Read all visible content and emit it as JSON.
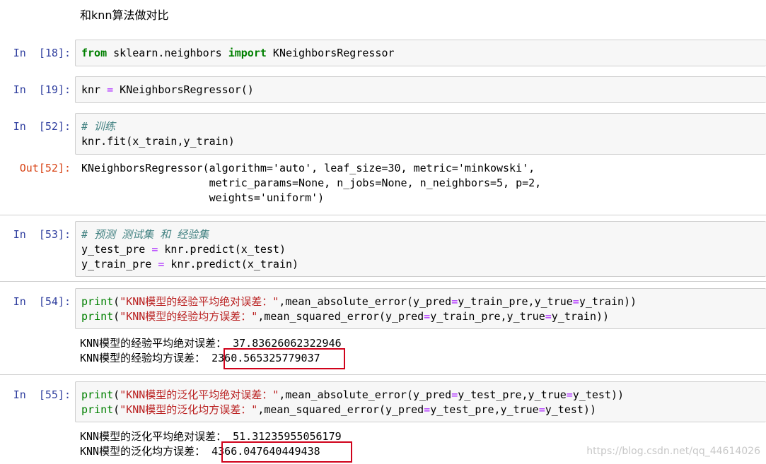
{
  "markdown": "和knn算法做对比",
  "cells": [
    {
      "prompt": "In  [18]:",
      "line1_kw1": "from",
      "line1_mid": " sklearn.neighbors ",
      "line1_kw2": "import",
      "line1_end": " KNeighborsRegressor"
    },
    {
      "prompt": "In  [19]:",
      "a": "knr ",
      "op": "=",
      "b": " KNeighborsRegressor()"
    },
    {
      "prompt": "In  [52]:",
      "comment": "# 训练",
      "code": "knr.fit(x_train,y_train)",
      "out_prompt": "Out[52]:",
      "out_lines": [
        "KNeighborsRegressor(algorithm='auto', leaf_size=30, metric='minkowski',",
        "                    metric_params=None, n_jobs=None, n_neighbors=5, p=2,",
        "                    weights='uniform')"
      ]
    },
    {
      "prompt": "In  [53]:",
      "comment": "# 预测 测试集 和 经验集",
      "l2a": "y_test_pre ",
      "l2op": "=",
      "l2b": " knr.predict(x_test)",
      "l3a": "y_train_pre ",
      "l3op": "=",
      "l3b": " knr.predict(x_train)"
    },
    {
      "prompt": "In  [54]:",
      "l1_fn": "print",
      "l1_p1": "(",
      "l1_str": "\"KNN模型的经验平均绝对误差：\"",
      "l1_rest": ",mean_absolute_error(y_pred",
      "l1_op1": "=",
      "l1_mid": "y_train_pre,y_true",
      "l1_op2": "=",
      "l1_end": "y_train))",
      "l2_fn": "print",
      "l2_p1": "(",
      "l2_str": "\"KNN模型的经验均方误差：\"",
      "l2_rest": ",mean_squared_error(y_pred",
      "l2_op1": "=",
      "l2_mid": "y_train_pre,y_true",
      "l2_op2": "=",
      "l2_end": "y_train))",
      "out1_label": "KNN模型的经验平均绝对误差：",
      "out1_value": " 37.83626062322946",
      "out2_label": "KNN模型的经验均方误差：",
      "out2_value": " 2360.565325779037"
    },
    {
      "prompt": "In  [55]:",
      "l1_fn": "print",
      "l1_p1": "(",
      "l1_str": "\"KNN模型的泛化平均绝对误差：\"",
      "l1_rest": ",mean_absolute_error(y_pred",
      "l1_op1": "=",
      "l1_mid": "y_test_pre,y_true",
      "l1_op2": "=",
      "l1_end": "y_test))",
      "l2_fn": "print",
      "l2_p1": "(",
      "l2_str": "\"KNN模型的泛化均方误差：\"",
      "l2_rest": ",mean_squared_error(y_pred",
      "l2_op1": "=",
      "l2_mid": "y_test_pre,y_true",
      "l2_op2": "=",
      "l2_end": "y_test))",
      "out1_label": "KNN模型的泛化平均绝对误差：",
      "out1_value": " 51.31235955056179",
      "out2_label": "KNN模型的泛化均方误差：",
      "out2_value": " 4366.047640449438"
    }
  ],
  "watermark": "https://blog.csdn.net/qq_44614026",
  "colors": {
    "prompt_in": "#303f9f",
    "prompt_out": "#d84315",
    "highlight": "#d0021b"
  }
}
